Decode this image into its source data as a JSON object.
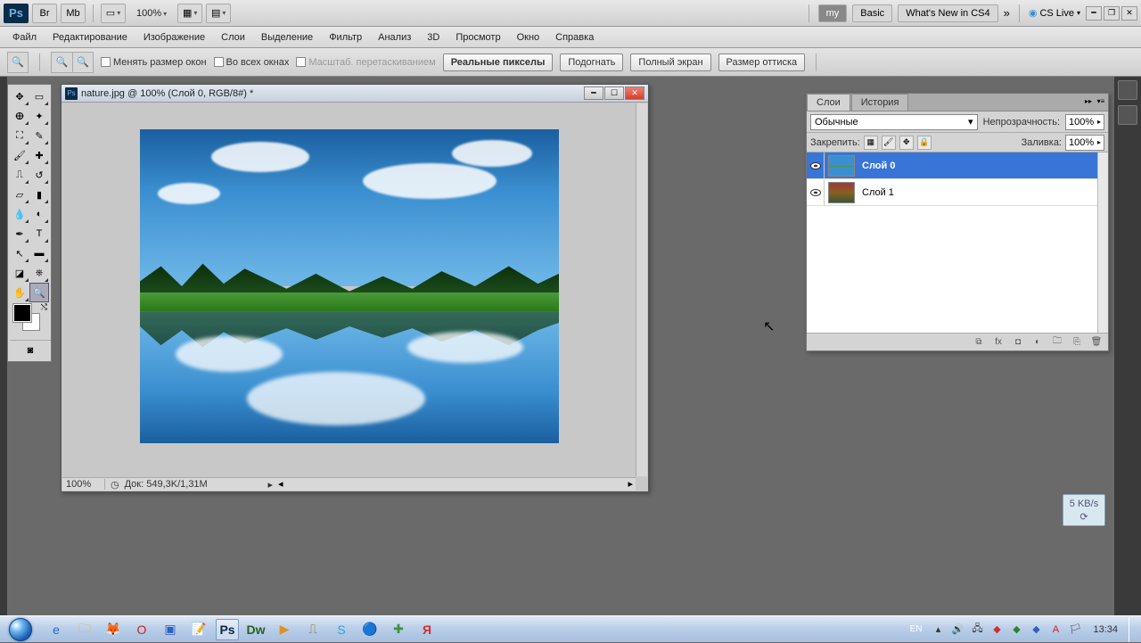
{
  "toolbar1": {
    "zoom": "100%",
    "workspaces": {
      "my": "my",
      "basic": "Basic",
      "whatsnew": "What's New in CS4"
    },
    "cslive": "CS Live"
  },
  "menubar": [
    "Файл",
    "Редактирование",
    "Изображение",
    "Слои",
    "Выделение",
    "Фильтр",
    "Анализ",
    "3D",
    "Просмотр",
    "Окно",
    "Справка"
  ],
  "optbar": {
    "resize_windows": "Менять размер окон",
    "all_windows": "Во всех окнах",
    "scrubby": "Масштаб. перетаскиванием",
    "actual_pixels": "Реальные пикселы",
    "fit": "Подогнать",
    "fullscreen": "Полный экран",
    "print_size": "Размер оттиска"
  },
  "doc": {
    "title": "nature.jpg @ 100% (Слой 0, RGB/8#) *",
    "status_zoom": "100%",
    "status_docsize": "Док: 549,3K/1,31M"
  },
  "layers_panel": {
    "tabs": {
      "layers": "Слои",
      "history": "История"
    },
    "blend_mode": "Обычные",
    "opacity_label": "Непрозрачность:",
    "opacity_value": "100%",
    "fill_label": "Заливка:",
    "fill_value": "100%",
    "lock_label": "Закрепить:",
    "layers": [
      {
        "name": "Слой 0",
        "selected": true
      },
      {
        "name": "Слой 1",
        "selected": false
      }
    ]
  },
  "float_widget": {
    "text": "5 KB/s"
  },
  "taskbar": {
    "lang": "EN",
    "time": "13:34"
  }
}
